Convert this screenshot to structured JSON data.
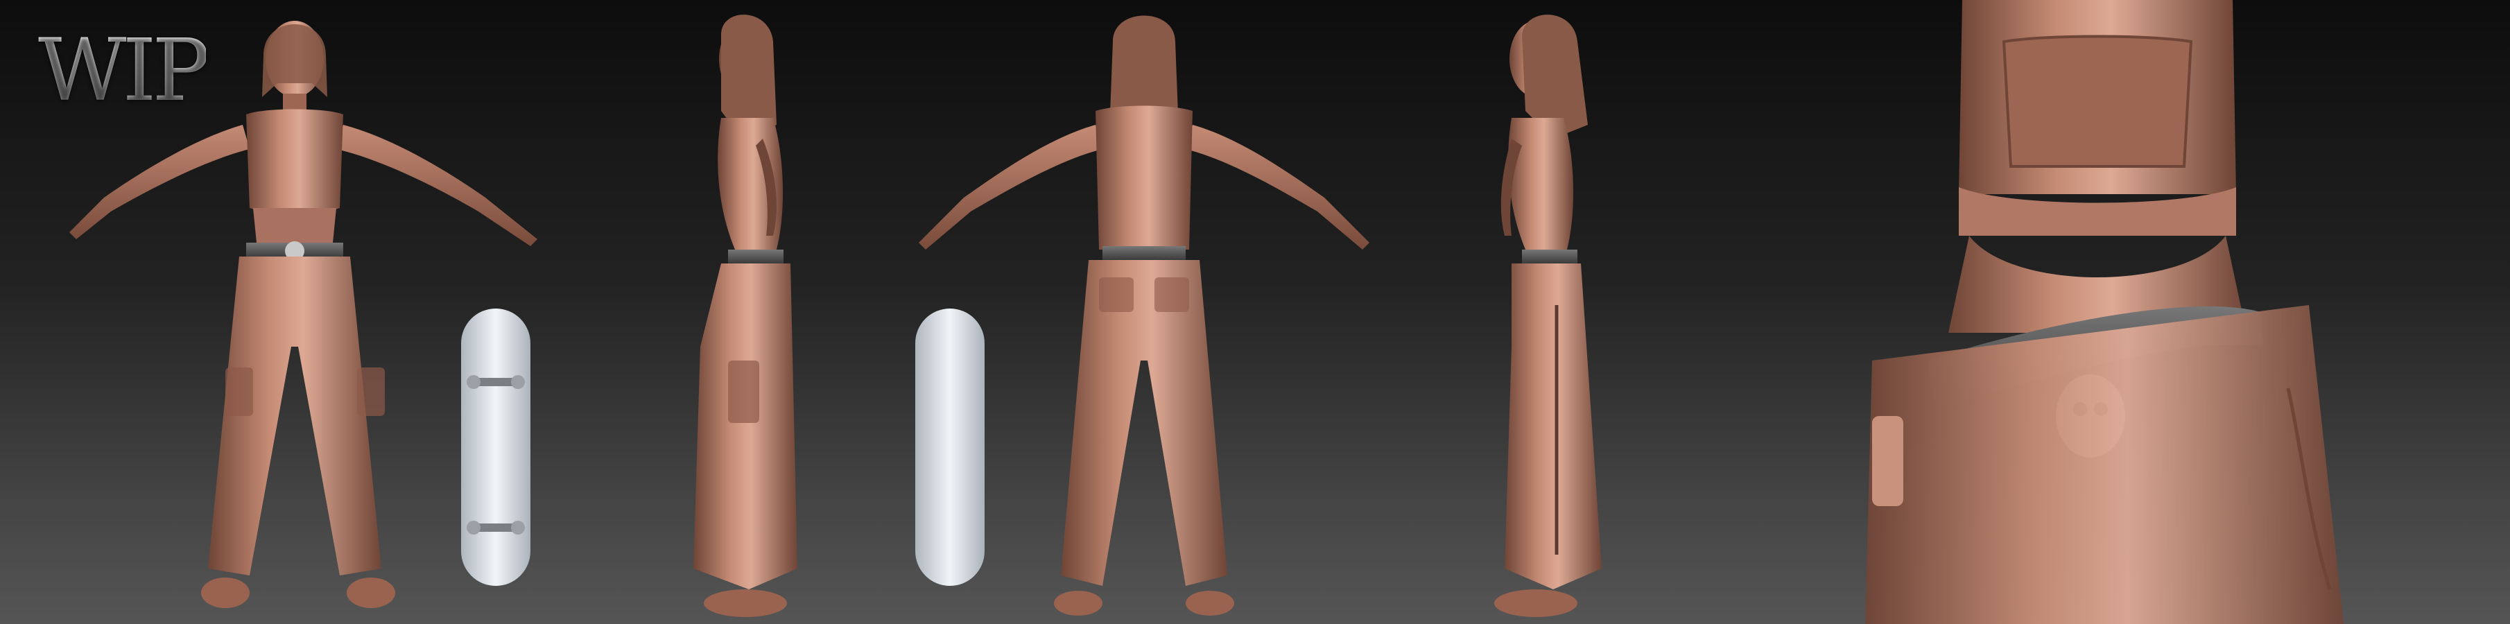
{
  "overlay": {
    "label": "WIP"
  },
  "palette": {
    "skin": "#b57a64",
    "skin_light": "#d9a591",
    "skin_dark": "#6f4537",
    "belt": "#555555",
    "board": "#e7ecf0",
    "background_top": "#0d0d0d",
    "background_bottom": "#555555"
  },
  "views": [
    {
      "name": "front-view"
    },
    {
      "name": "side-view-right"
    },
    {
      "name": "back-view"
    },
    {
      "name": "side-view-left"
    },
    {
      "name": "waist-closeup"
    }
  ]
}
